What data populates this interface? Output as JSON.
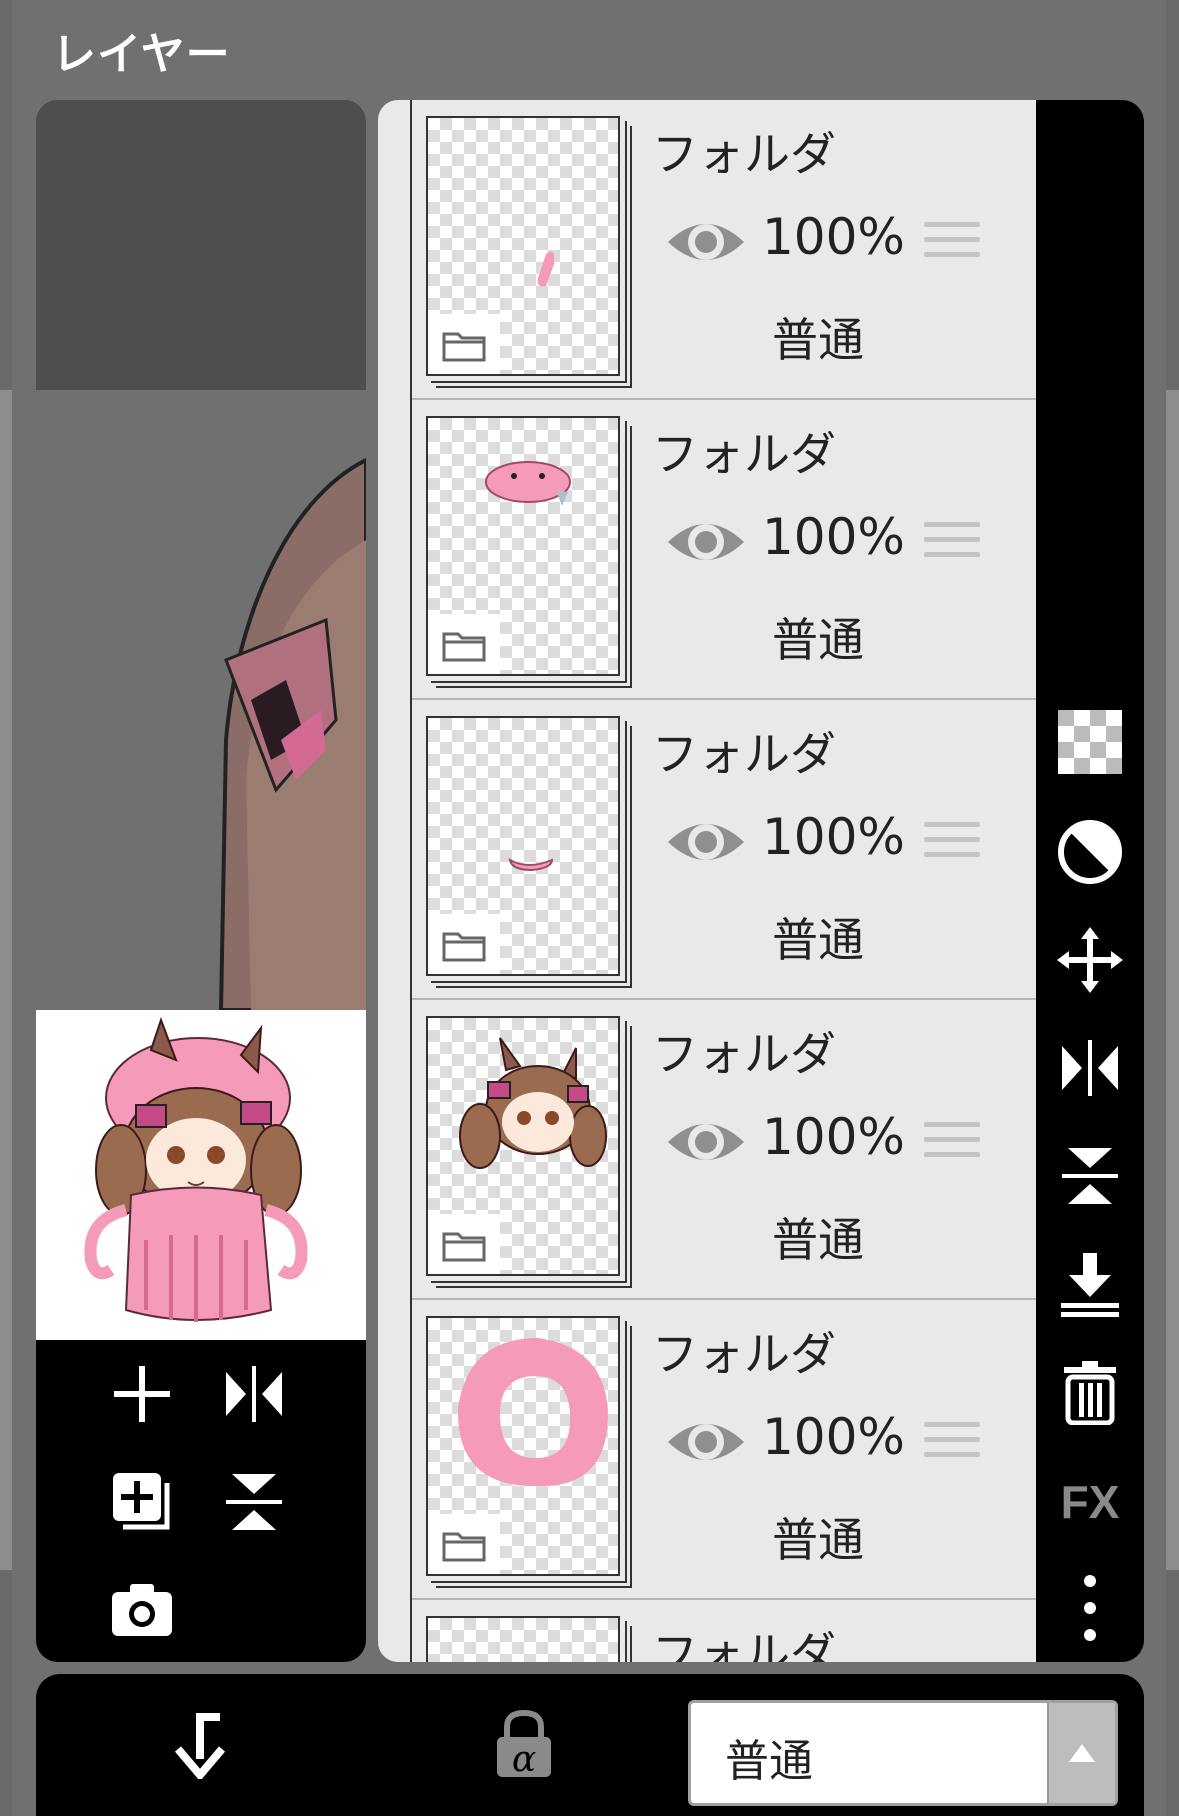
{
  "panel": {
    "title": "レイヤー"
  },
  "layers": [
    {
      "name": "フォルダ",
      "opacity": "100%",
      "blend": "普通"
    },
    {
      "name": "フォルダ",
      "opacity": "100%",
      "blend": "普通"
    },
    {
      "name": "フォルダ",
      "opacity": "100%",
      "blend": "普通"
    },
    {
      "name": "フォルダ",
      "opacity": "100%",
      "blend": "普通"
    },
    {
      "name": "フォルダ",
      "opacity": "100%",
      "blend": "普通"
    },
    {
      "name": "フォルダ",
      "opacity": "",
      "blend": ""
    }
  ],
  "left_tools": [
    "add-layer-icon",
    "flip-horizontal-icon",
    "add-copy-layer-icon",
    "flip-vertical-icon",
    "camera-icon"
  ],
  "right_tools": [
    "transparency-icon",
    "clipping-icon",
    "move-icon",
    "flip-horizontal-icon",
    "flip-vertical-icon",
    "merge-down-icon",
    "trash-icon",
    "fx-icon",
    "more-icon"
  ],
  "right_bar": {
    "fx_label": "FX"
  },
  "bottom": {
    "clipping_icon": "clipping-arrow-icon",
    "alpha_lock_icon": "alpha-lock-icon",
    "blend_mode": "普通"
  },
  "colors": {
    "accent_pink": "#f59ab8",
    "panel_bg": "#707070",
    "list_bg": "#e9e9e9"
  }
}
